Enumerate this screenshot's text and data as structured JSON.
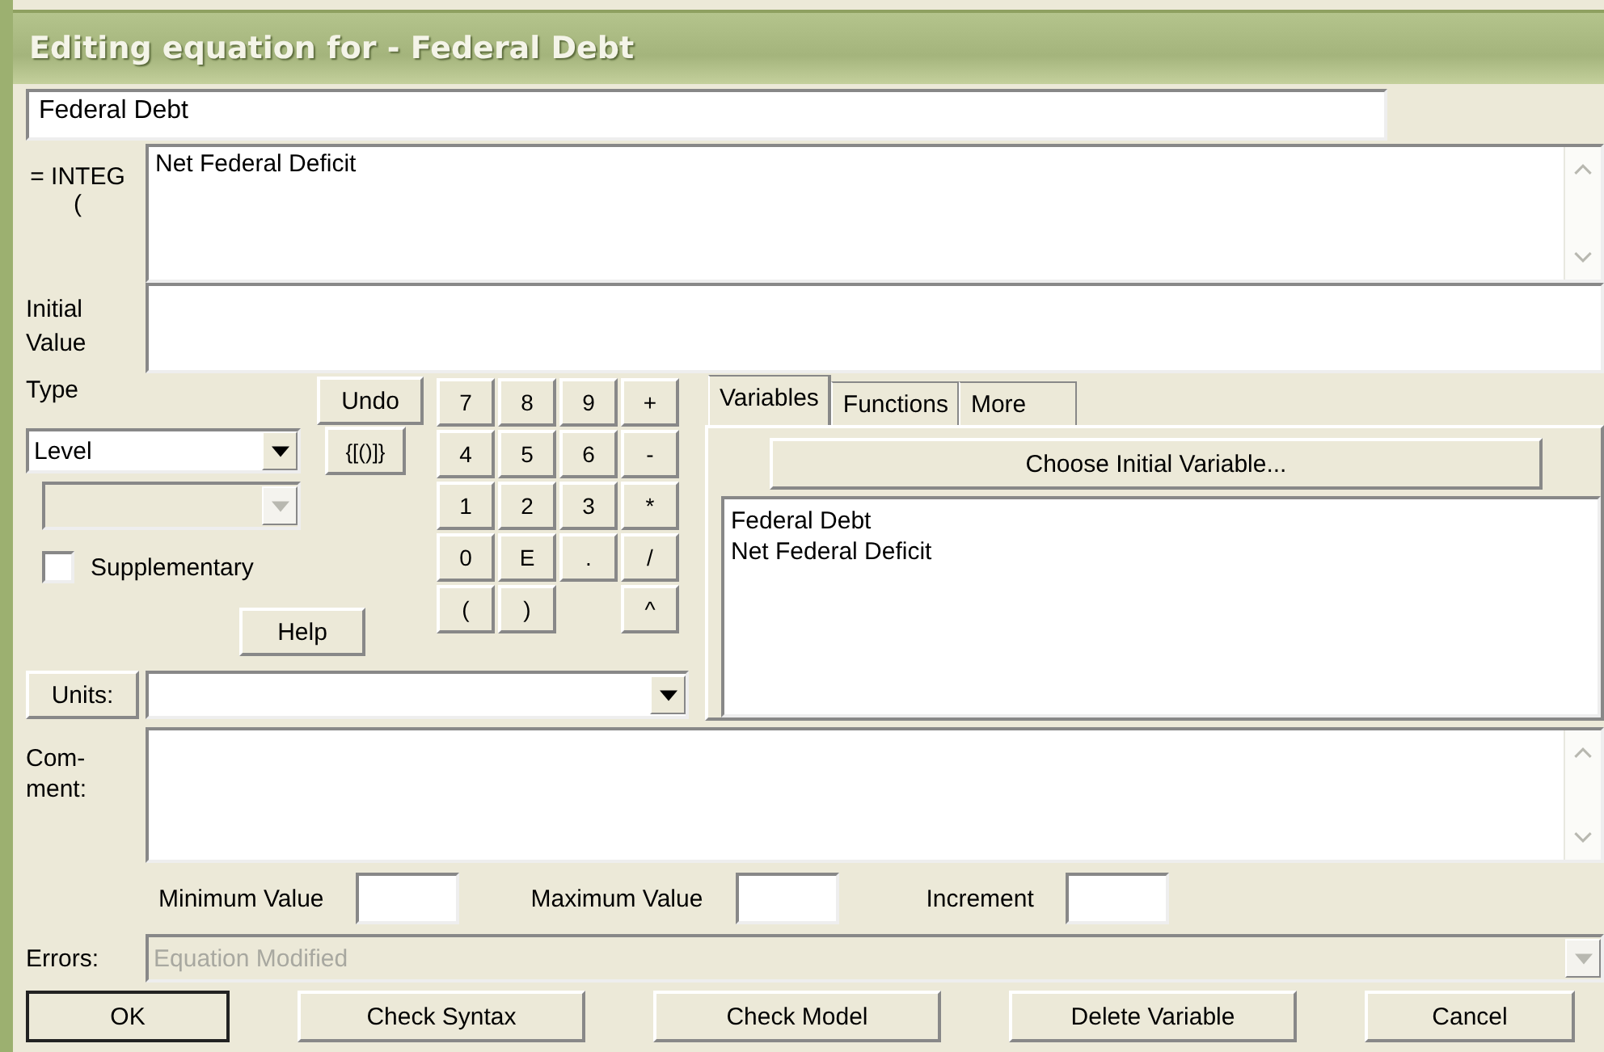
{
  "window": {
    "title": "Editing equation for - Federal Debt"
  },
  "variable_name": {
    "value": "Federal Debt"
  },
  "equation": {
    "label": "= INTEG (",
    "value": "Net Federal Deficit"
  },
  "initial_value": {
    "label": "Initial Value"
  },
  "type": {
    "label": "Type",
    "value": "Level",
    "subtype_disabled": true
  },
  "supplementary": {
    "label": "Supplementary",
    "checked": false
  },
  "side_buttons": {
    "undo": "Undo",
    "brackets": "{[()]}",
    "help": "Help"
  },
  "keypad": [
    [
      {
        "kind": "key",
        "label": "7"
      },
      {
        "kind": "key",
        "label": "8"
      },
      {
        "kind": "key",
        "label": "9"
      },
      {
        "kind": "key",
        "label": "+"
      }
    ],
    [
      {
        "kind": "key",
        "label": "4"
      },
      {
        "kind": "key",
        "label": "5"
      },
      {
        "kind": "key",
        "label": "6"
      },
      {
        "kind": "key",
        "label": "-"
      }
    ],
    [
      {
        "kind": "key",
        "label": "1"
      },
      {
        "kind": "key",
        "label": "2"
      },
      {
        "kind": "key",
        "label": "3"
      },
      {
        "kind": "key",
        "label": "*"
      }
    ],
    [
      {
        "kind": "key",
        "label": "0"
      },
      {
        "kind": "key",
        "label": "E"
      },
      {
        "kind": "key",
        "label": "."
      },
      {
        "kind": "key",
        "label": "/"
      }
    ],
    [
      {
        "kind": "key",
        "label": "("
      },
      {
        "kind": "key",
        "label": ")"
      },
      {
        "kind": "blank"
      },
      {
        "kind": "key",
        "label": "^"
      }
    ]
  ],
  "tabs": [
    {
      "label": "Variables",
      "selected": true
    },
    {
      "label": "Functions",
      "selected": false
    },
    {
      "label": "More",
      "selected": false
    }
  ],
  "choose_button": "Choose Initial Variable...",
  "variables": [
    {
      "label": "Federal Debt",
      "selected": false
    },
    {
      "label": "Net Federal Deficit",
      "selected": false
    }
  ],
  "units": {
    "label": "Units:"
  },
  "comment": {
    "label": "Com-ment:"
  },
  "limits": [
    {
      "label": "Minimum Value"
    },
    {
      "label": "Maximum Value"
    },
    {
      "label": "Increment"
    }
  ],
  "errors": {
    "label": "Errors:",
    "value": "Equation Modified",
    "disabled": true
  },
  "buttons": [
    {
      "label": "OK",
      "default": true
    },
    {
      "label": "Check Syntax",
      "default": false
    },
    {
      "label": "Check Model",
      "default": false
    },
    {
      "label": "Delete Variable",
      "default": false
    },
    {
      "label": "Cancel",
      "default": false
    }
  ]
}
